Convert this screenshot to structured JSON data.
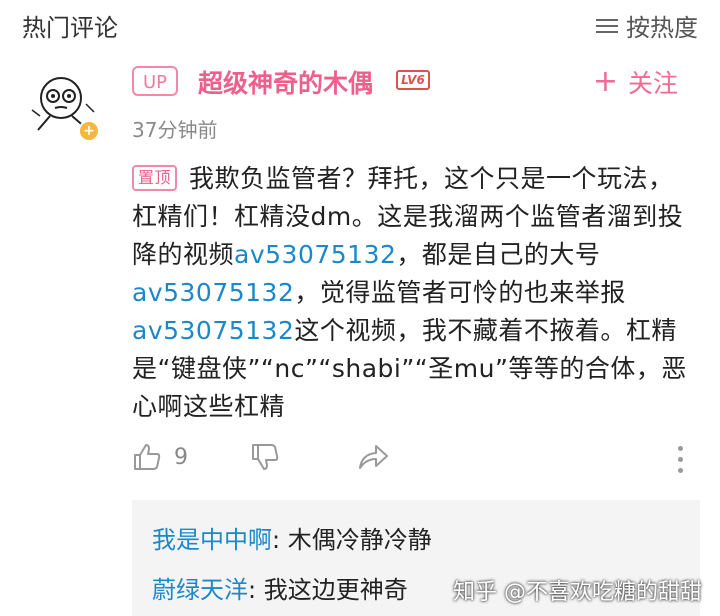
{
  "header": {
    "title": "热门评论",
    "sort_label": "按热度"
  },
  "comment": {
    "up_badge": "UP",
    "username": "超级神奇的木偶",
    "level": "LV6",
    "follow_label": "关注",
    "timestamp": "37分钟前",
    "pinned_label": "置顶",
    "body_part1": "我欺负监管者？拜托，这个只是一个玩法，杠精们！杠精没dm。这是我溜两个监管者溜到投降的视频",
    "link1": "av53075132",
    "body_part2": "，都是自己的大号",
    "link2": "av53075132",
    "body_part3": "，觉得监管者可怜的也来举报",
    "link3": "av53075132",
    "body_part4": "这个视频，我不藏着不掖着。杠精是“键盘侠”“nc”“shabi”“圣mu”等等的合体，恶心啊这些杠精",
    "like_count": "9"
  },
  "replies": [
    {
      "name": "我是中中啊",
      "text": ": 木偶冷静冷静"
    },
    {
      "name": "蔚绿天洋",
      "text": ": 我这边更神奇"
    }
  ],
  "watermark": "知乎 @不喜欢吃糖的甜甜",
  "colors": {
    "accent_pink": "#ef5f8c",
    "link_blue": "#1b88c9"
  }
}
